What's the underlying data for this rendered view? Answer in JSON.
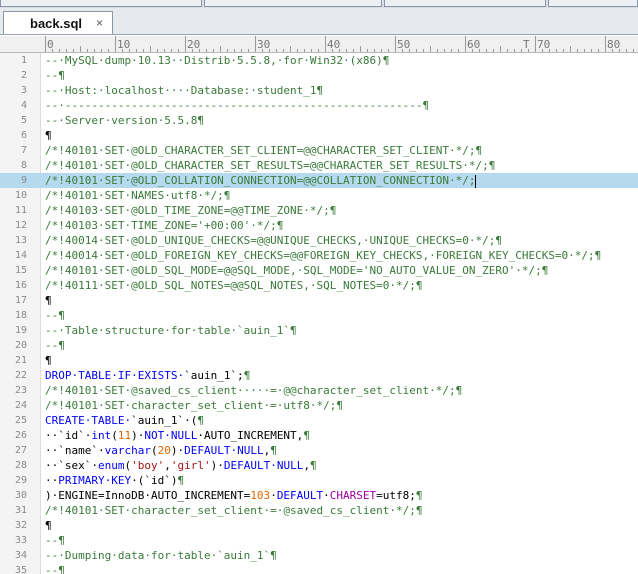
{
  "tab": {
    "filename": "back.sql",
    "close_glyph": "×"
  },
  "ruler": {
    "labels": [
      "0",
      "10",
      "20",
      "30",
      "40",
      "50",
      "60",
      "T",
      "70",
      "80"
    ]
  },
  "colors": {
    "highlight_line": "#b5d9ef",
    "comment": "#3a7a3a",
    "keyword": "#0000ff",
    "string": "#a31515",
    "number": "#e66400"
  },
  "editor": {
    "highlight_line": 9,
    "lines": [
      {
        "n": "1",
        "tokens": [
          [
            "comment",
            "--·MySQL·dump·10.13··Distrib·5.5.8,·for·Win32·(x86)¶"
          ]
        ]
      },
      {
        "n": "2",
        "tokens": [
          [
            "comment",
            "--¶"
          ]
        ]
      },
      {
        "n": "3",
        "tokens": [
          [
            "comment",
            "--·Host:·localhost····Database:·student_1¶"
          ]
        ]
      },
      {
        "n": "4",
        "tokens": [
          [
            "comment",
            "--·------------------------------------------------------¶"
          ]
        ]
      },
      {
        "n": "5",
        "tokens": [
          [
            "comment",
            "--·Server·version·5.5.8¶"
          ]
        ]
      },
      {
        "n": "6",
        "tokens": [
          [
            "plain",
            "¶"
          ]
        ]
      },
      {
        "n": "7",
        "tokens": [
          [
            "comment",
            "/*!40101·SET·@OLD_CHARACTER_SET_CLIENT=@@CHARACTER_SET_CLIENT·*/;¶"
          ]
        ]
      },
      {
        "n": "8",
        "tokens": [
          [
            "comment",
            "/*!40101·SET·@OLD_CHARACTER_SET_RESULTS=@@CHARACTER_SET_RESULTS·*/;¶"
          ]
        ]
      },
      {
        "n": "9",
        "tokens": [
          [
            "comment",
            "/*!40101·SET·@OLD_COLLATION_CONNECTION=@@COLLATION_CONNECTION·*/;"
          ]
        ]
      },
      {
        "n": "10",
        "tokens": [
          [
            "comment",
            "/*!40101·SET·NAMES·utf8·*/;¶"
          ]
        ]
      },
      {
        "n": "11",
        "tokens": [
          [
            "comment",
            "/*!40103·SET·@OLD_TIME_ZONE=@@TIME_ZONE·*/;¶"
          ]
        ]
      },
      {
        "n": "12",
        "tokens": [
          [
            "comment",
            "/*!40103·SET·TIME_ZONE='+00:00'·*/;¶"
          ]
        ]
      },
      {
        "n": "13",
        "tokens": [
          [
            "comment",
            "/*!40014·SET·@OLD_UNIQUE_CHECKS=@@UNIQUE_CHECKS,·UNIQUE_CHECKS=0·*/;¶"
          ]
        ]
      },
      {
        "n": "14",
        "tokens": [
          [
            "comment",
            "/*!40014·SET·@OLD_FOREIGN_KEY_CHECKS=@@FOREIGN_KEY_CHECKS,·FOREIGN_KEY_CHECKS=0·*/;¶"
          ]
        ]
      },
      {
        "n": "15",
        "tokens": [
          [
            "comment",
            "/*!40101·SET·@OLD_SQL_MODE=@@SQL_MODE,·SQL_MODE='NO_AUTO_VALUE_ON_ZERO'·*/;¶"
          ]
        ]
      },
      {
        "n": "16",
        "tokens": [
          [
            "comment",
            "/*!40111·SET·@OLD_SQL_NOTES=@@SQL_NOTES,·SQL_NOTES=0·*/;¶"
          ]
        ]
      },
      {
        "n": "17",
        "tokens": [
          [
            "plain",
            "¶"
          ]
        ]
      },
      {
        "n": "18",
        "tokens": [
          [
            "comment",
            "--¶"
          ]
        ]
      },
      {
        "n": "19",
        "tokens": [
          [
            "comment",
            "--·Table·structure·for·table·`auin_1`¶"
          ]
        ]
      },
      {
        "n": "20",
        "tokens": [
          [
            "comment",
            "--¶"
          ]
        ]
      },
      {
        "n": "21",
        "tokens": [
          [
            "plain",
            "¶"
          ]
        ]
      },
      {
        "n": "22",
        "tokens": [
          [
            "keyword",
            "DROP·TABLE·IF·EXISTS·"
          ],
          [
            "plain",
            "`auin_1`;"
          ],
          [
            "comment",
            "¶"
          ]
        ]
      },
      {
        "n": "23",
        "tokens": [
          [
            "comment",
            "/*!40101·SET·@saved_cs_client·····=·@@character_set_client·*/;¶"
          ]
        ]
      },
      {
        "n": "24",
        "tokens": [
          [
            "comment",
            "/*!40101·SET·character_set_client·=·utf8·*/;¶"
          ]
        ]
      },
      {
        "n": "25",
        "tokens": [
          [
            "keyword",
            "CREATE·TABLE·"
          ],
          [
            "plain",
            "`auin_1`·("
          ],
          [
            "comment",
            "¶"
          ]
        ]
      },
      {
        "n": "26",
        "tokens": [
          [
            "plain",
            "··`id`·"
          ],
          [
            "keyword",
            "int"
          ],
          [
            "plain",
            "("
          ],
          [
            "number",
            "11"
          ],
          [
            "plain",
            ")·"
          ],
          [
            "keyword",
            "NOT·NULL"
          ],
          [
            "plain",
            "·AUTO_INCREMENT,"
          ],
          [
            "comment",
            "¶"
          ]
        ]
      },
      {
        "n": "27",
        "tokens": [
          [
            "plain",
            "··`name`·"
          ],
          [
            "keyword",
            "varchar"
          ],
          [
            "plain",
            "("
          ],
          [
            "number",
            "20"
          ],
          [
            "plain",
            ")·"
          ],
          [
            "keyword",
            "DEFAULT·NULL"
          ],
          [
            "plain",
            ","
          ],
          [
            "comment",
            "¶"
          ]
        ]
      },
      {
        "n": "28",
        "tokens": [
          [
            "plain",
            "··`sex`·"
          ],
          [
            "keyword",
            "enum"
          ],
          [
            "plain",
            "("
          ],
          [
            "string",
            "'boy'"
          ],
          [
            "plain",
            ","
          ],
          [
            "string",
            "'girl'"
          ],
          [
            "plain",
            ")·"
          ],
          [
            "keyword",
            "DEFAULT·NULL"
          ],
          [
            "plain",
            ","
          ],
          [
            "comment",
            "¶"
          ]
        ]
      },
      {
        "n": "29",
        "tokens": [
          [
            "plain",
            "··"
          ],
          [
            "keyword",
            "PRIMARY·KEY"
          ],
          [
            "plain",
            "·(`id`)"
          ],
          [
            "comment",
            "¶"
          ]
        ]
      },
      {
        "n": "30",
        "tokens": [
          [
            "plain",
            ")·ENGINE=InnoDB·AUTO_INCREMENT="
          ],
          [
            "number",
            "103"
          ],
          [
            "plain",
            "·"
          ],
          [
            "keyword",
            "DEFAULT"
          ],
          [
            "plain",
            "·"
          ],
          [
            "type",
            "CHARSET"
          ],
          [
            "plain",
            "=utf8;"
          ],
          [
            "comment",
            "¶"
          ]
        ]
      },
      {
        "n": "31",
        "tokens": [
          [
            "comment",
            "/*!40101·SET·character_set_client·=·@saved_cs_client·*/;¶"
          ]
        ]
      },
      {
        "n": "32",
        "tokens": [
          [
            "plain",
            "¶"
          ]
        ]
      },
      {
        "n": "33",
        "tokens": [
          [
            "comment",
            "--¶"
          ]
        ]
      },
      {
        "n": "34",
        "tokens": [
          [
            "comment",
            "--·Dumping·data·for·table·`auin_1`¶"
          ]
        ]
      },
      {
        "n": "35",
        "tokens": [
          [
            "comment",
            "--¶"
          ]
        ]
      }
    ]
  }
}
